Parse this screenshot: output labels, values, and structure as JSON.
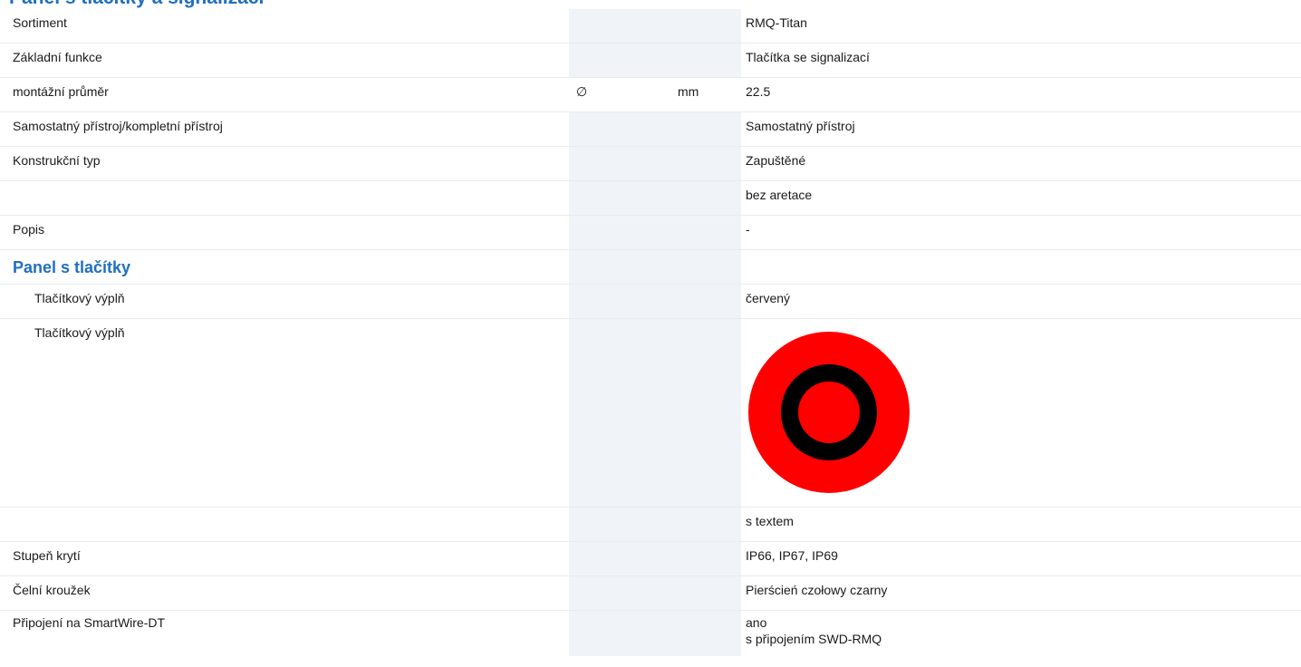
{
  "header": {
    "title": "Panel s tlačítky a signalizací"
  },
  "rows": {
    "sortiment": {
      "label": "Sortiment",
      "value": "RMQ-Titan"
    },
    "zakladni_funkce": {
      "label": "Základní funkce",
      "value": "Tlačítka se signalizací"
    },
    "montazni_prumer": {
      "label": "montážní průměr",
      "symbol": "∅",
      "unit": "mm",
      "value": "22.5"
    },
    "samostatny": {
      "label": "Samostatný přístroj/kompletní přístroj",
      "value": "Samostatný přístroj"
    },
    "konstrukcni_typ": {
      "label": "Konstrukční typ",
      "value": "Zapuštěné"
    },
    "aretace": {
      "label": "",
      "value": "bez aretace"
    },
    "popis": {
      "label": "Popis",
      "value": "-"
    },
    "panel_section": {
      "title": "Panel s tlačítky"
    },
    "vypln_text": {
      "label": "Tlačítkový výplň",
      "value": "červený"
    },
    "vypln_image": {
      "label": "Tlačítkový výplň",
      "outer_color": "#ff0000",
      "ring_color": "#000000",
      "inner_color": "#ff0000"
    },
    "s_textem": {
      "label": "",
      "value": "s textem"
    },
    "stupen_kryti": {
      "label": "Stupeň krytí",
      "value": "IP66, IP67, IP69"
    },
    "celni_krouzek": {
      "label": "Čelní kroužek",
      "value": "Pierścień czołowy czarny"
    },
    "smartwire": {
      "label": "Připojení na SmartWire-DT",
      "value_line1": "ano",
      "value_line2": "s připojením SWD-RMQ"
    }
  }
}
